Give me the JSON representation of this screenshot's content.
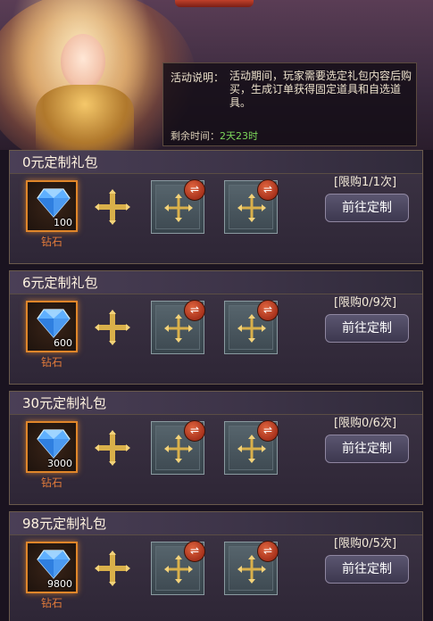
{
  "event": {
    "label": "活动说明：",
    "description": "活动期间，玩家需要选定礼包内容后购买，生成订单获得固定道具和自选道具。",
    "remain_label": "剩余时间：",
    "remain_time": "2天23时"
  },
  "packs": [
    {
      "title": "0元定制礼包",
      "diamond_count": "100",
      "diamond_label": "钻石",
      "limit": "[限购1/1次]",
      "button": "前往定制"
    },
    {
      "title": "6元定制礼包",
      "diamond_count": "600",
      "diamond_label": "钻石",
      "limit": "[限购0/9次]",
      "button": "前往定制"
    },
    {
      "title": "30元定制礼包",
      "diamond_count": "3000",
      "diamond_label": "钻石",
      "limit": "[限购0/6次]",
      "button": "前往定制"
    },
    {
      "title": "98元定制礼包",
      "diamond_count": "9800",
      "diamond_label": "钻石",
      "limit": "[限购0/5次]",
      "button": "前往定制"
    }
  ],
  "icons": {
    "diamond": "diamond-icon",
    "plus": "plus-icon",
    "select_slot": "cross-arrows-icon",
    "swap": "swap-icon"
  },
  "colors": {
    "accent_orange": "#e0862a",
    "timer_green": "#7cd65a",
    "swap_red": "#c8472a"
  }
}
